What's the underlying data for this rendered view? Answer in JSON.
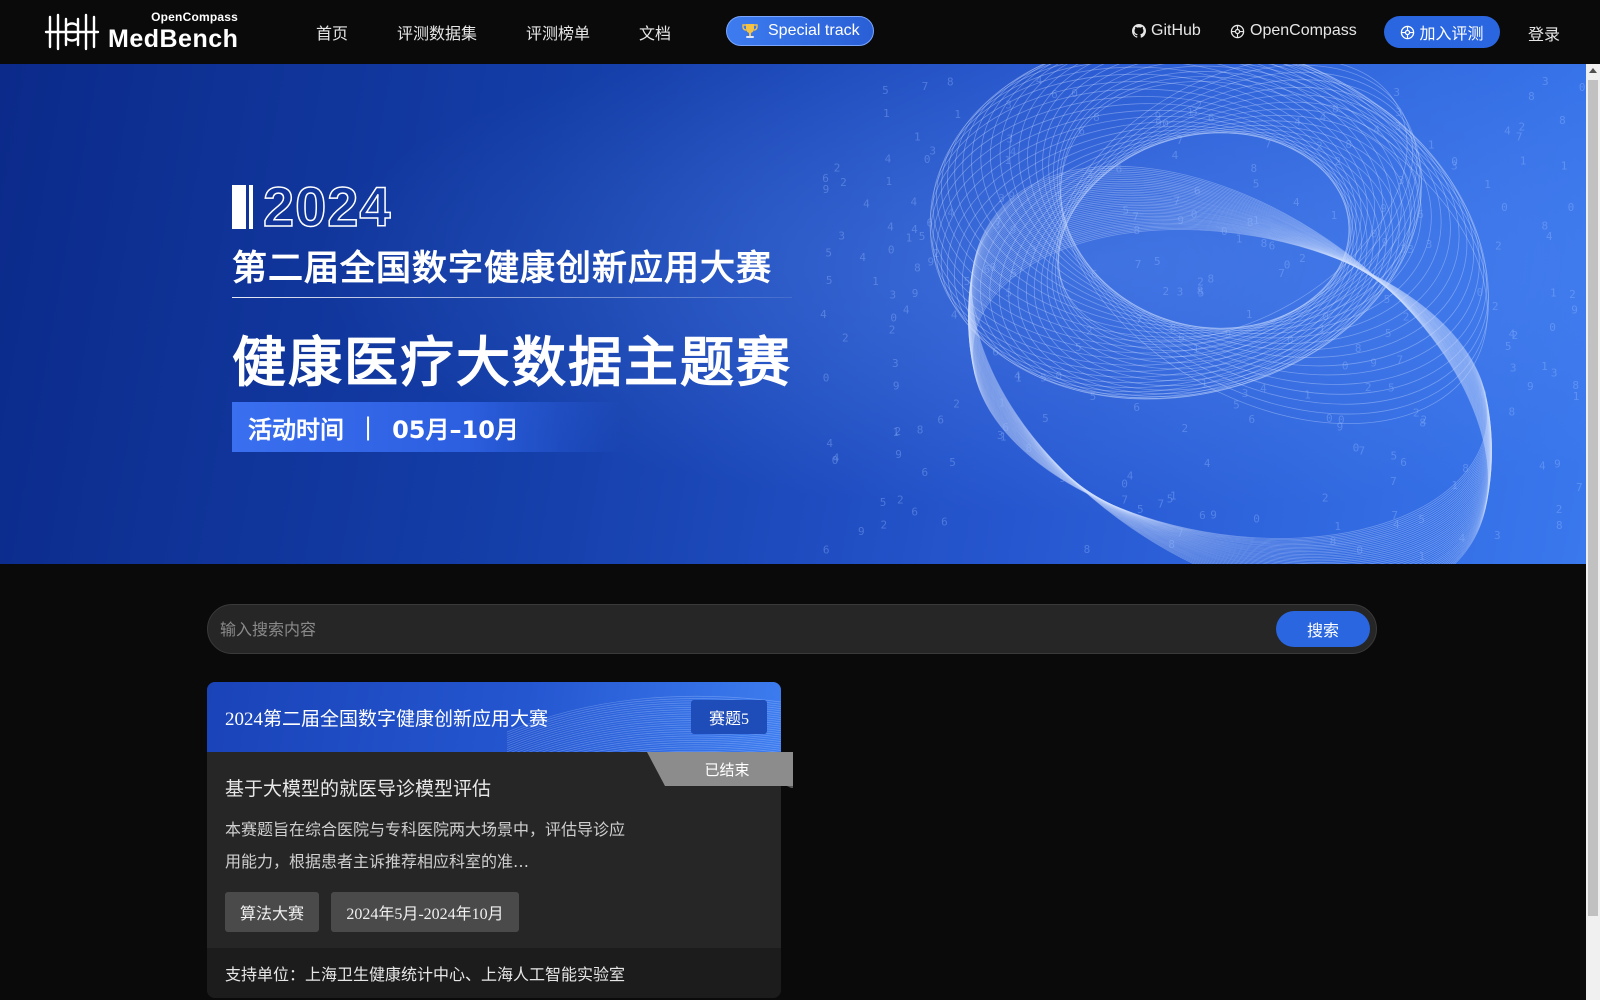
{
  "nav": {
    "logo_sup": "OpenCompass",
    "logo_main": "MedBench",
    "links": [
      "首页",
      "评测数据集",
      "评测榜单",
      "文档"
    ],
    "special_track": "Special track",
    "github": "GitHub",
    "opencompass": "OpenCompass",
    "join": "加入评测",
    "login": "登录"
  },
  "banner": {
    "year": "2024",
    "title1": "第二届全国数字健康创新应用大赛",
    "title2": "健康医疗大数据主题赛",
    "time_label": "活动时间",
    "time_sep": "|",
    "time_value": "05月–10月"
  },
  "search": {
    "placeholder": "输入搜索内容",
    "button": "搜索"
  },
  "card": {
    "header_title": "2024第二届全国数字健康创新应用大赛",
    "badge": "赛题5",
    "status": "已结束",
    "title": "基于大模型的就医导诊模型评估",
    "description": "本赛题旨在综合医院与专科医院两大场景中，评估导诊应用能力，根据患者主诉推荐相应科室的准…",
    "tags": [
      "算法大赛",
      "2024年5月-2024年10月"
    ],
    "footer": "支持单位：上海卫生健康统计中心、上海人工智能实验室"
  },
  "colors": {
    "accent": "#2a66e0",
    "banner_dark": "#0b2a8a",
    "banner_light": "#3a78ee",
    "page_bg": "#0a0a0a",
    "card_bg": "#262626"
  }
}
